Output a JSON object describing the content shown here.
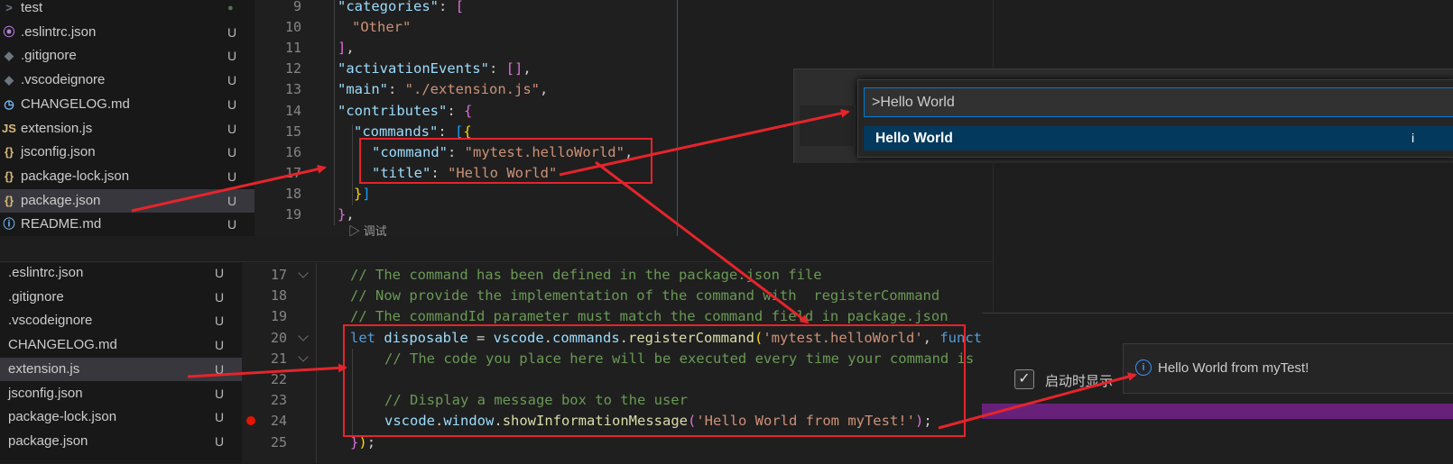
{
  "top_explorer": {
    "items": [
      {
        "icon": ">",
        "label": "test",
        "status": "●",
        "cls": "c-grey"
      },
      {
        "icon": "⦿",
        "label": ".eslintrc.json",
        "status": "U",
        "cls": "c-purple"
      },
      {
        "icon": "◆",
        "label": ".gitignore",
        "status": "U",
        "cls": "c-grey"
      },
      {
        "icon": "◆",
        "label": ".vscodeignore",
        "status": "U",
        "cls": "c-grey"
      },
      {
        "icon": "◷",
        "label": "CHANGELOG.md",
        "status": "U",
        "cls": "c-blue"
      },
      {
        "icon": "JS",
        "label": "extension.js",
        "status": "U",
        "cls": "c-yellow"
      },
      {
        "icon": "{}",
        "label": "jsconfig.json",
        "status": "U",
        "cls": "c-yellow"
      },
      {
        "icon": "{}",
        "label": "package-lock.json",
        "status": "U",
        "cls": "c-yellow"
      },
      {
        "icon": "{}",
        "label": "package.json",
        "status": "U",
        "cls": "c-yellow"
      },
      {
        "icon": "ⓘ",
        "label": "README.md",
        "status": "U",
        "cls": "c-blue"
      }
    ]
  },
  "bottom_explorer": {
    "items": [
      {
        "label": ".eslintrc.json",
        "status": "U"
      },
      {
        "label": ".gitignore",
        "status": "U"
      },
      {
        "label": ".vscodeignore",
        "status": "U"
      },
      {
        "label": "CHANGELOG.md",
        "status": "U"
      },
      {
        "label": "extension.js",
        "status": "U"
      },
      {
        "label": "jsconfig.json",
        "status": "U"
      },
      {
        "label": "package-lock.json",
        "status": "U"
      },
      {
        "label": "package.json",
        "status": "U"
      }
    ]
  },
  "package_json_editor": {
    "line_numbers": [
      "9",
      "10",
      "11",
      "12",
      "13",
      "14",
      "15",
      "16",
      "17",
      "18",
      "19"
    ],
    "codelens": "▷ 调试"
  },
  "extension_editor": {
    "line_numbers": [
      "17",
      "18",
      "19",
      "20",
      "21",
      "22",
      "23",
      "24",
      "25"
    ]
  },
  "command_palette": {
    "input_value": ">Hello World",
    "result_label": "Hello World",
    "result_trailing": "i"
  },
  "notification": {
    "message": "Hello World from myTest!"
  },
  "welcome": {
    "checkbox_label": "启动时显示"
  },
  "colors": {
    "annotation_red": "#e5242b",
    "accent_blue": "#0078d4",
    "purple_bar": "#68217a"
  }
}
